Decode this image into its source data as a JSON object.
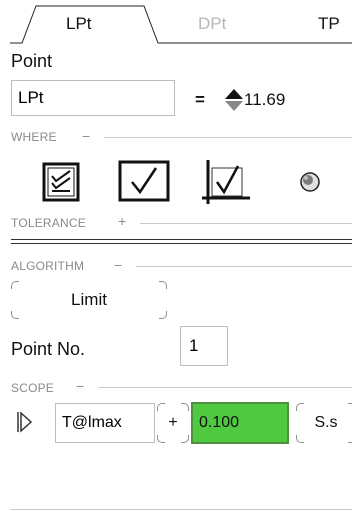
{
  "tabs": [
    {
      "label": "LPt",
      "active": true
    },
    {
      "label": "DPt",
      "active": false
    },
    {
      "label": "TP",
      "active": false
    }
  ],
  "point": {
    "title": "Point",
    "input_value": "LPt",
    "equals": "=",
    "value": "11.69"
  },
  "where": {
    "header": "WHERE",
    "toggle": "−",
    "icons": [
      "checklist-icon",
      "checkbox-icon",
      "checkbox-axes-icon",
      "sphere-icon"
    ]
  },
  "tolerance": {
    "header": "TOLERANCE",
    "toggle": "+"
  },
  "algorithm": {
    "header": "ALGORITHM",
    "toggle": "−",
    "button_label": "Limit"
  },
  "point_no": {
    "label": "Point No.",
    "value": "1"
  },
  "scope": {
    "header": "SCOPE",
    "toggle": "−",
    "param": "T@lmax",
    "plus": "+",
    "value": "0.100",
    "unit": "S.s"
  },
  "colors": {
    "highlight": "#4fc93f",
    "highlight_border": "#4f8f3f",
    "muted_text": "#b8b8b8",
    "section_header": "#8a8a8a"
  }
}
